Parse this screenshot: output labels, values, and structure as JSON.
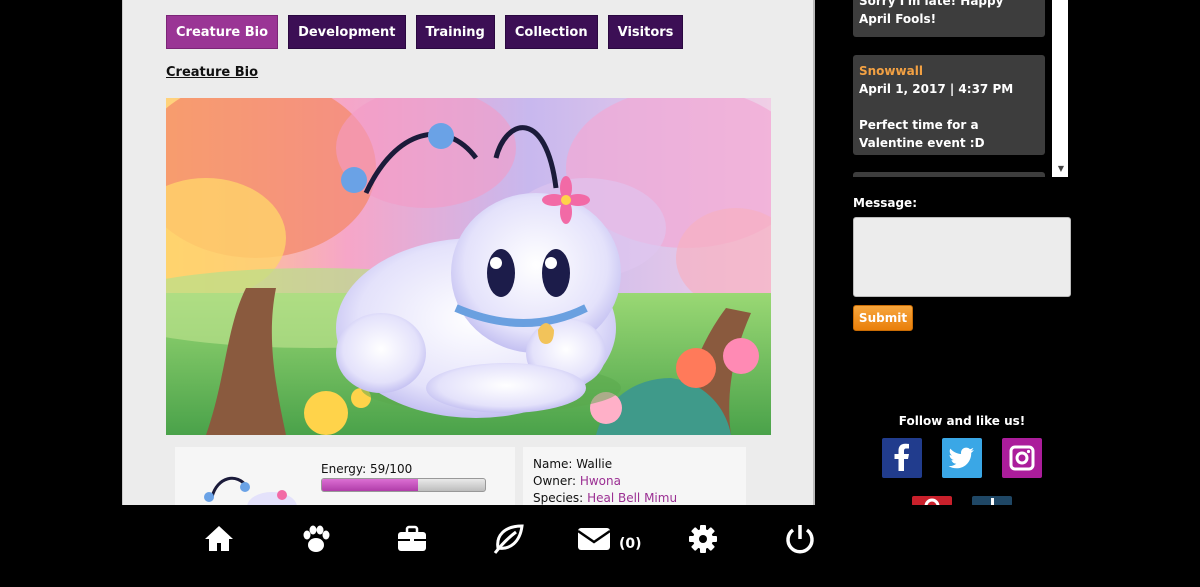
{
  "tabs": [
    {
      "label": "Creature Bio",
      "active": true
    },
    {
      "label": "Development",
      "active": false
    },
    {
      "label": "Training",
      "active": false
    },
    {
      "label": "Collection",
      "active": false
    },
    {
      "label": "Visitors",
      "active": false
    }
  ],
  "section_title": "Creature Bio",
  "stats": {
    "energy_label": "Energy: 59/100",
    "energy_value": 59,
    "energy_max": 100
  },
  "info": {
    "name_label": "Name:",
    "name_value": "Wallie",
    "owner_label": "Owner:",
    "owner_value": "Hwona",
    "species_label": "Species:",
    "species_value": "Heal Bell Mimu"
  },
  "chat": {
    "messages": [
      {
        "user": "",
        "time": "",
        "text": "Sorry I'm late! Happy April Fools!"
      },
      {
        "user": "Snowwall",
        "time": "April 1, 2017 | 4:37 PM",
        "text": "Perfect time for a Valentine event :D"
      }
    ]
  },
  "message_form": {
    "label": "Message:",
    "placeholder": "",
    "submit_label": "Submit"
  },
  "social": {
    "follow_label": "Follow and like us!",
    "icons": [
      "facebook-icon",
      "twitter-icon",
      "instagram-icon",
      "pinterest-icon",
      "tumblr-icon"
    ]
  },
  "bottom_nav": {
    "icons": [
      "home-icon",
      "paw-icon",
      "briefcase-icon",
      "leaf-icon",
      "mail-icon",
      "gear-icon",
      "power-icon"
    ],
    "mail_count": "(0)"
  },
  "colors": {
    "tab_bg": "#3c0f55",
    "tab_active": "#9a3595",
    "link": "#9b2f93",
    "chat_user": "#f3a143",
    "submit": "#e97f0a"
  }
}
